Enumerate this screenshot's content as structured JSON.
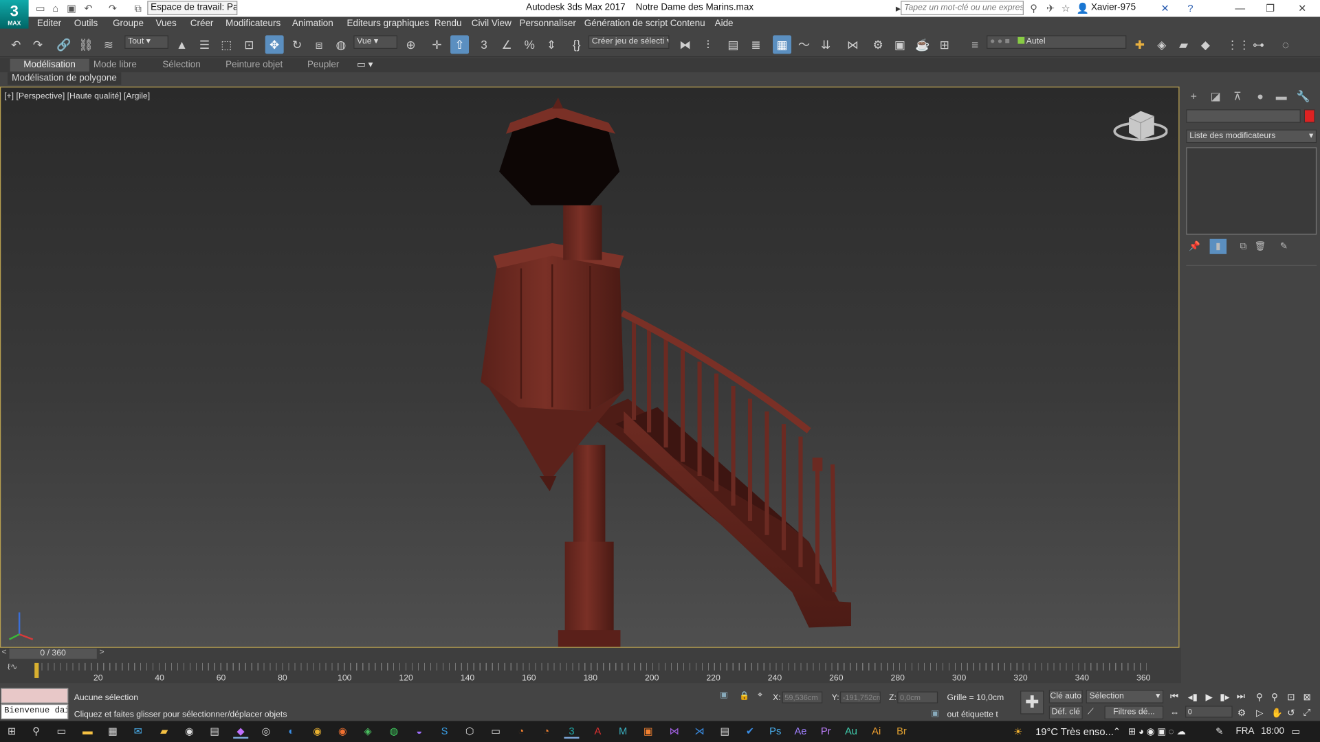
{
  "app": {
    "logo_text": "3",
    "logo_sub": "MAX",
    "workspace": "Espace de travail: Par",
    "title": "Autodesk 3ds Max 2017",
    "file": "Notre Dame des Marins.max",
    "search_placeholder": "Tapez un mot-clé ou une expression",
    "user": "Xavier-975"
  },
  "menu": [
    "Editer",
    "Outils",
    "Groupe",
    "Vues",
    "Créer",
    "Modificateurs",
    "Animation",
    "Editeurs graphiques",
    "Rendu",
    "Civil View",
    "Personnaliser",
    "Génération de script",
    "Contenu",
    "Aide"
  ],
  "toolbar": {
    "selection_filter": "Tout",
    "reference_coord": "Vue",
    "named_selection": "Créer jeu de sélecti",
    "layer": "Autel"
  },
  "ribbon": {
    "tabs": [
      "Modélisation",
      "Mode libre",
      "Sélection",
      "Peinture objet",
      "Peupler"
    ],
    "active_tab": "Modélisation",
    "panel": "Modélisation de polygone"
  },
  "viewport": {
    "label": "[+] [Perspective] [Haute qualité] [Argile]",
    "model_color": "#6b2a22"
  },
  "command_panel": {
    "modifier_list": "Liste des modificateurs",
    "object_color": "#d62020"
  },
  "timeline": {
    "frame_indicator": "0 / 360",
    "ticks": [
      "20",
      "40",
      "60",
      "80",
      "100",
      "120",
      "140",
      "160",
      "180",
      "200",
      "220",
      "240",
      "260",
      "280",
      "300",
      "320",
      "340",
      "360"
    ]
  },
  "status": {
    "listener": "Bienvenue dai",
    "selection": "Aucune sélection",
    "prompt": "Cliquez et faites glisser pour sélectionner/déplacer objets",
    "x_label": "X:",
    "x_value": "59,536cm",
    "y_label": "Y:",
    "y_value": "-191,752cm",
    "z_label": "Z:",
    "z_value": "0,0cm",
    "grid": "Grille = 10,0cm",
    "add_tag": "out étiquette t",
    "auto_key": "Clé auto",
    "set_key": "Déf. clé",
    "key_mode": "Sélection",
    "key_filters": "Filtres dé...",
    "current_frame": "0"
  },
  "taskbar": {
    "weather": "19°C Très enso...",
    "language": "FRA",
    "time": "18:00"
  }
}
